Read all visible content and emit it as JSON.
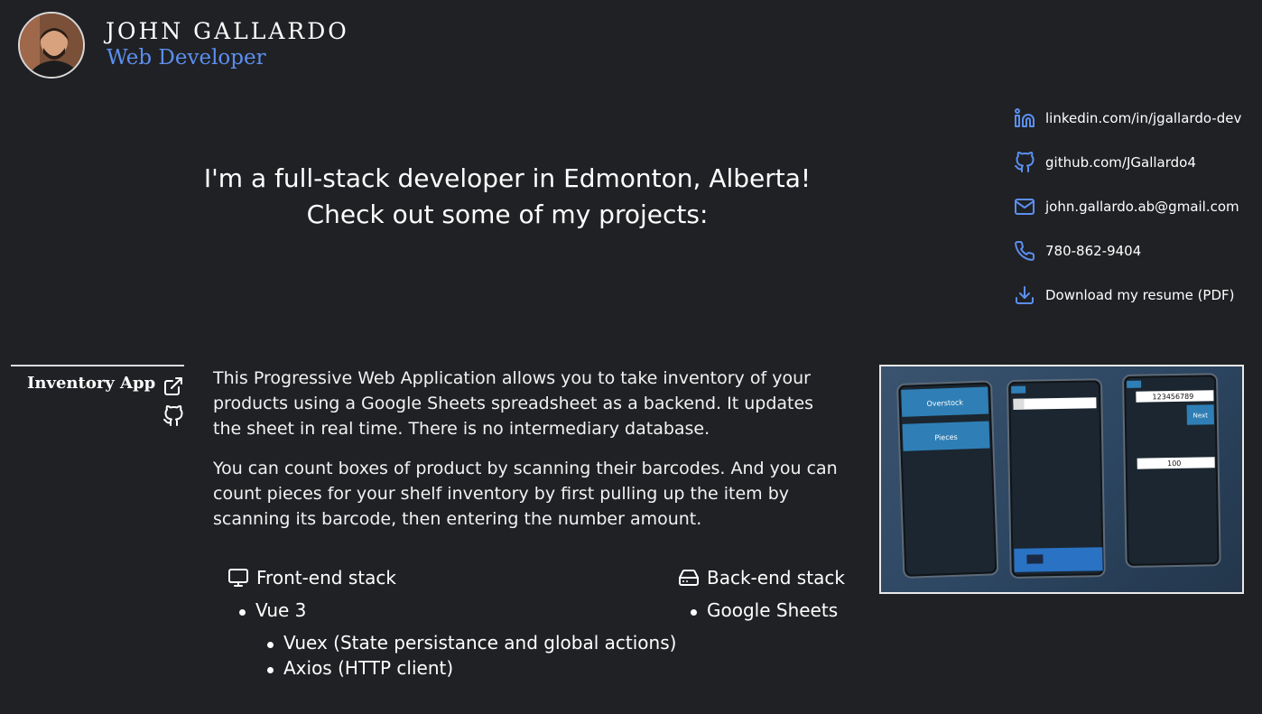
{
  "header": {
    "name": "JOHN GALLARDO",
    "role": "Web Developer"
  },
  "contacts": [
    {
      "icon": "linkedin-icon",
      "text": "linkedin.com/in/jgallardo-dev"
    },
    {
      "icon": "github-icon",
      "text": "github.com/JGallardo4"
    },
    {
      "icon": "mail-icon",
      "text": "john.gallardo.ab@gmail.com"
    },
    {
      "icon": "phone-icon",
      "text": "780-862-9404"
    },
    {
      "icon": "download-icon",
      "text": "Download my resume (PDF)"
    }
  ],
  "intro": {
    "line1": "I'm a full-stack developer in Edmonton, Alberta!",
    "line2": "Check out some of my projects:"
  },
  "project": {
    "title": "Inventory App",
    "description": [
      "This Progressive Web Application allows you to take inventory of your products using a Google Sheets spreadsheet as a backend. It updates the sheet in real time. There is no intermediary database.",
      "You can count boxes of product by scanning their barcodes. And you can count pieces for your shelf inventory by first pulling up the item by scanning its barcode, then entering the number amount."
    ],
    "frontend": {
      "heading": "Front-end stack",
      "items": [
        "Vue 3"
      ],
      "subitems": [
        "Vuex (State persistance and global actions)",
        "Axios (HTTP client)"
      ]
    },
    "backend": {
      "heading": "Back-end stack",
      "items": [
        "Google Sheets"
      ]
    },
    "screenshot": {
      "btn_overstock": "Overstock",
      "btn_pieces": "Pieces",
      "scan_value": "123456789",
      "next_label": "Next",
      "qty_value": "100"
    }
  },
  "colors": {
    "background": "#202124",
    "accent": "#5b8ff0",
    "text": "#ffffff"
  }
}
